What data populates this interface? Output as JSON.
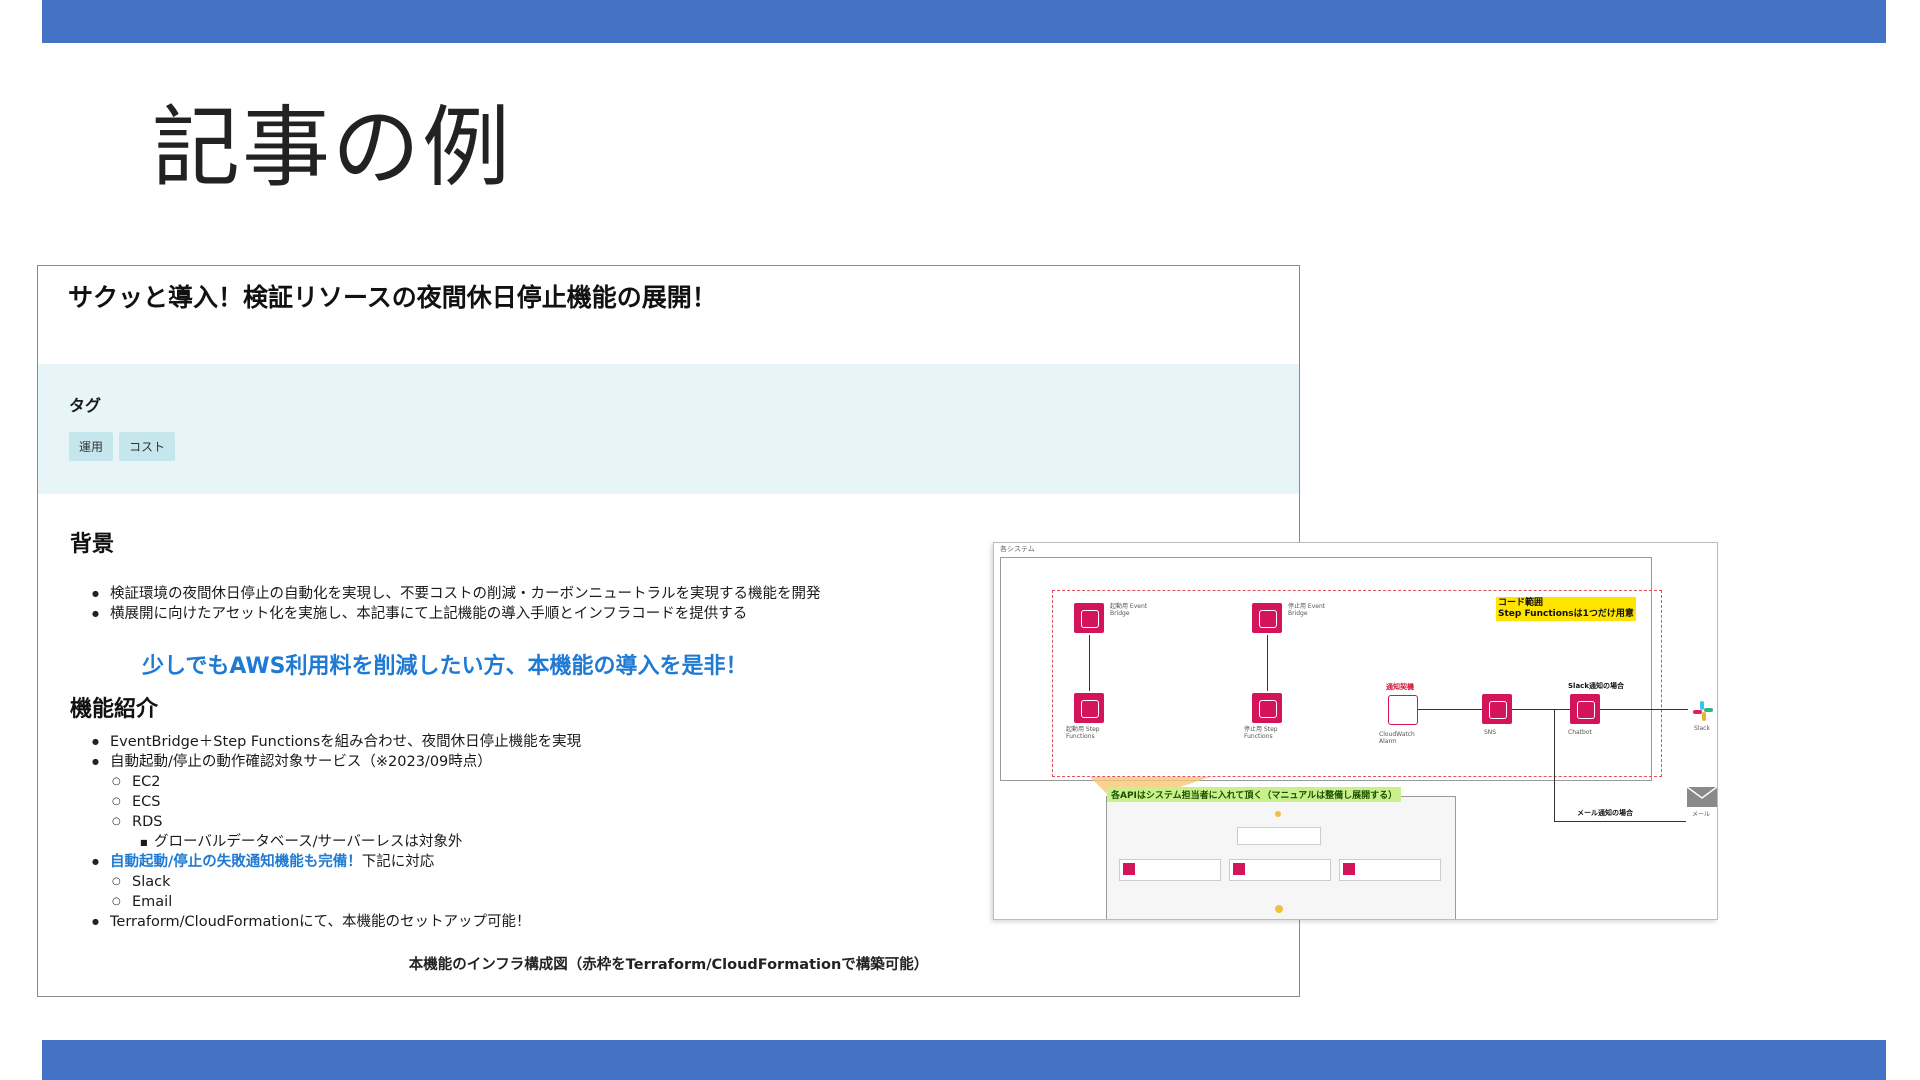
{
  "slide": {
    "title": "記事の例",
    "colors": {
      "band": "#4472c4",
      "accent": "#1f7ad4"
    }
  },
  "article": {
    "title": "サクッと導入！検証リソースの夜間休日停止機能の展開！",
    "tags_heading": "タグ",
    "tags": [
      "運用",
      "コスト"
    ],
    "background_heading": "背景",
    "background_items": [
      "検証環境の夜間休日停止の自動化を実現し、不要コストの削減・カーボンニュートラルを実現する機能を開発",
      "横展開に向けたアセット化を実施し、本記事にて上記機能の導入手順とインフラコードを提供する"
    ],
    "highlight": "少しでもAWS利用料を削減したい方、本機能の導入を是非！",
    "features_heading": "機能紹介",
    "features": {
      "item1": "EventBridge＋Step Functionsを組み合わせ、夜間休日停止機能を実現",
      "item2": "自動起動/停止の動作確認対象サービス（※2023/09時点）",
      "ec2": "EC2",
      "ecs": "ECS",
      "rds": "RDS",
      "rds_note": "グローバルデータベース/サーバーレスは対象外",
      "item3_blue": "自動起動/停止の失敗通知機能も完備！",
      "item3_rest": "下記に対応",
      "slack": "Slack",
      "email": "Email",
      "item4": "Terraform/CloudFormationにて、本機能のセットアップ可能！"
    },
    "caption": "本機能のインフラ構成図（赤枠をTerraform/CloudFormationで構築可能）"
  },
  "diagram": {
    "label": "各システム",
    "note_line1": "コード範囲",
    "note_line2": "Step Functionsは1つだけ用意",
    "start_label_1": "起動用 Event Bridge",
    "start_label_2": "停止用 Event Bridge",
    "sf_label_1": "起動用 Step Functions",
    "sf_label_2": "停止用 Step Functions",
    "notice_label": "通知契機",
    "slack_case": "Slack通知の場合",
    "mail_case": "メール通知の場合",
    "slack_target": "Slack",
    "mail_target": "メール",
    "api_note": "各APIはシステム担当者に入れて頂く（マニュアルは整備し展開する）",
    "alarm": "CloudWatch Alarm",
    "sns_label": "SNS",
    "chatbot_label": "Chatbot"
  }
}
